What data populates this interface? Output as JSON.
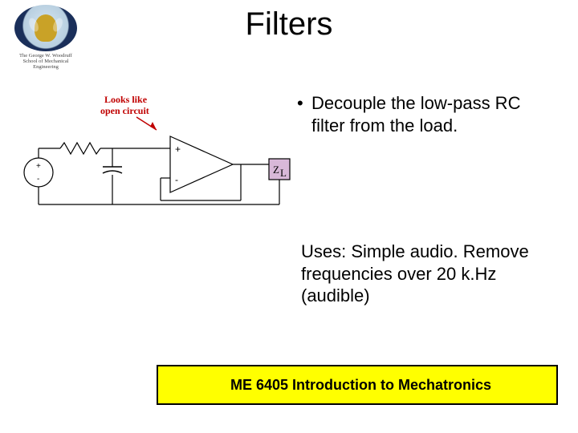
{
  "title": "Filters",
  "logo": {
    "caption_line1": "The George W. Woodruff",
    "caption_line2": "School of Mechanical Engineering"
  },
  "bullet": "Decouple the low-pass RC filter from the load.",
  "uses": "Uses: Simple audio. Remove frequencies over 20 k.Hz (audible)",
  "footer": "ME 6405  Introduction to Mechatronics",
  "circuit": {
    "annotation_line1": "Looks like",
    "annotation_line2": "open circuit",
    "opamp_plus": "+",
    "opamp_minus": "-",
    "source_plus": "+",
    "source_minus": "-",
    "load_label": "Z",
    "load_subscript": "L"
  }
}
